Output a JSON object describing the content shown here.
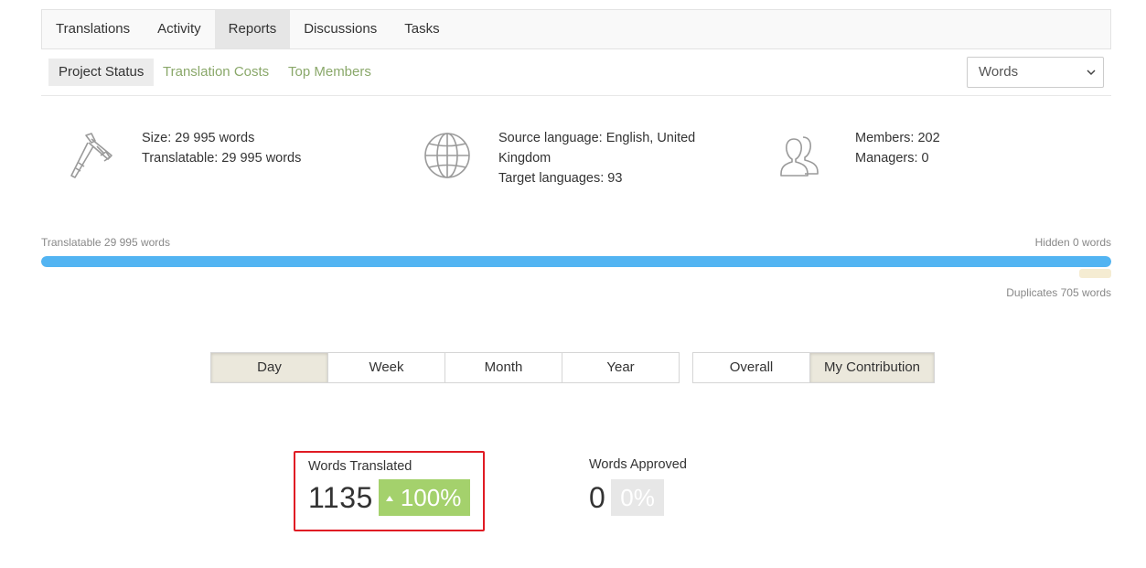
{
  "tabs": [
    {
      "label": "Translations",
      "active": false
    },
    {
      "label": "Activity",
      "active": false
    },
    {
      "label": "Reports",
      "active": true
    },
    {
      "label": "Discussions",
      "active": false
    },
    {
      "label": "Tasks",
      "active": false
    }
  ],
  "subtabs": [
    {
      "label": "Project Status",
      "active": true
    },
    {
      "label": "Translation Costs",
      "active": false
    },
    {
      "label": "Top Members",
      "active": false
    }
  ],
  "unit_select": {
    "value": "Words"
  },
  "info": {
    "size": {
      "icon": "caliper-icon",
      "line1": "Size: 29 995 words",
      "line2": "Translatable: 29 995 words"
    },
    "language": {
      "icon": "globe-icon",
      "line1": "Source language: English, United",
      "line2": "Kingdom",
      "line3": "Target languages: 93"
    },
    "members": {
      "icon": "users-icon",
      "line1": "Members: 202",
      "line2": "Managers: 0"
    }
  },
  "progress": {
    "left_label": "Translatable 29 995 words",
    "right_label": "Hidden 0 words",
    "bottom_label": "Duplicates 705 words",
    "translatable_fraction": 1.0,
    "duplicates_fraction": 0.0235,
    "fill_color": "#52b4f2",
    "duplicate_color": "#f5ecd2"
  },
  "period_buttons": [
    {
      "label": "Day",
      "active": true
    },
    {
      "label": "Week",
      "active": false
    },
    {
      "label": "Month",
      "active": false
    },
    {
      "label": "Year",
      "active": false
    }
  ],
  "scope_buttons": [
    {
      "label": "Overall",
      "active": false
    },
    {
      "label": "My Contribution",
      "active": true
    }
  ],
  "stats": {
    "translated": {
      "label": "Words Translated",
      "value": "1135",
      "change": "100%",
      "trend": "up",
      "color": "#a4d16c"
    },
    "approved": {
      "label": "Words Approved",
      "value": "0",
      "change": "0%",
      "color": "#e7e7e7"
    }
  },
  "highlight_color": "#e01b24"
}
